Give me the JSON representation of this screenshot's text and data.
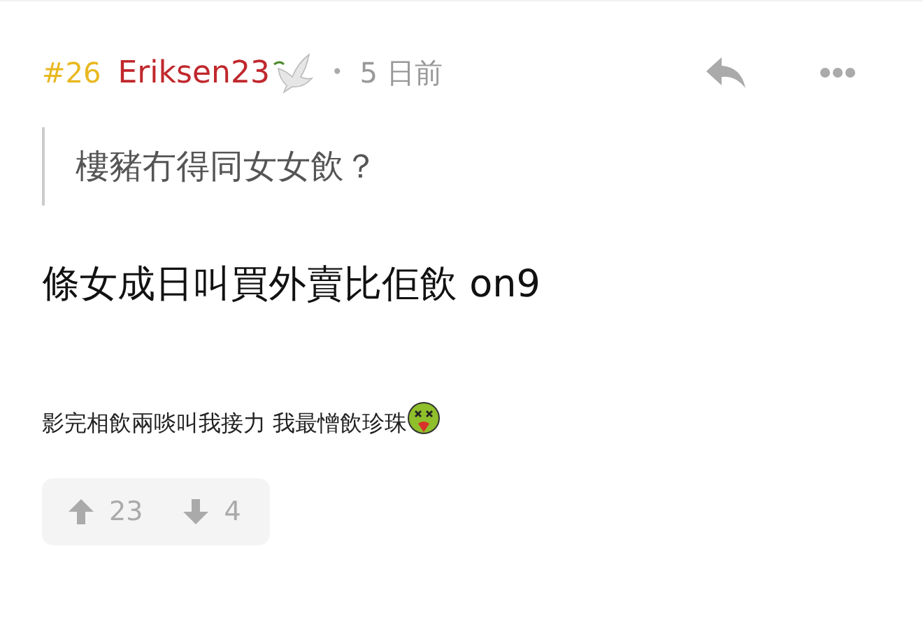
{
  "post": {
    "number": "#26",
    "author": "Eriksen23",
    "separator": "•",
    "time": "5 日前"
  },
  "quote": "樓豬冇得同女女飲？",
  "body": "條女成日叫買外賣比佢飲 on9",
  "footnote": "影完相飲兩啖叫我接力 我最憎飲珍珠",
  "votes": {
    "up": "23",
    "down": "4"
  }
}
